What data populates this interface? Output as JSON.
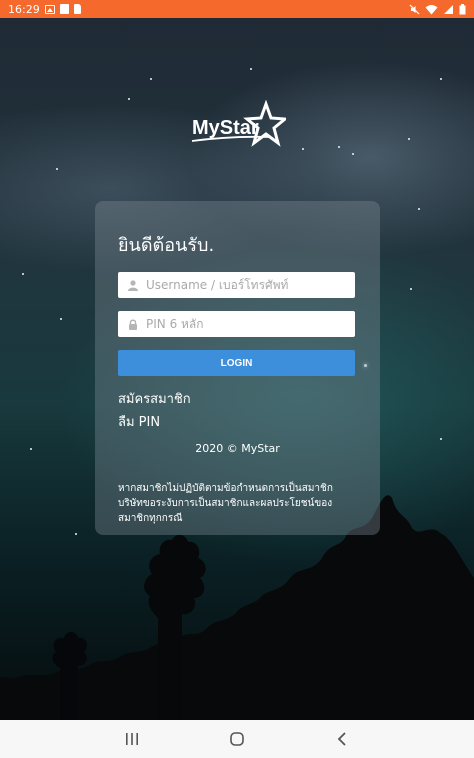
{
  "status_bar": {
    "time": "16:29",
    "left_icons": [
      "image-icon",
      "pdf-icon",
      "sd-card-icon"
    ],
    "right_icons": [
      "mute-icon",
      "wifi-icon",
      "signal-icon",
      "battery-icon"
    ],
    "background_color": "#f5692c"
  },
  "logo": {
    "text": "MyStar"
  },
  "login_card": {
    "welcome": "ยินดีต้อนรับ.",
    "username_placeholder": "Username / เบอร์โทรศัพท์",
    "pin_placeholder": "PIN 6 หลัก",
    "login_label": "LOGIN",
    "register_link": "สมัครสมาชิก",
    "forgot_pin_link": "ลืม PIN",
    "copyright": "2020 © MyStar",
    "notice_lines": [
      "หากสมาชิกไม่ปฏิบัติตามข้อกำหนดการเป็นสมาชิก",
      "บริษัทขอระงับการเป็นสมาชิกและผลประโยชน์ของ",
      "สมาชิกทุกกรณี"
    ],
    "accent_color": "#3d8fdb"
  },
  "nav_bar": {
    "buttons": [
      "recent-apps-icon",
      "home-icon",
      "back-icon"
    ]
  }
}
